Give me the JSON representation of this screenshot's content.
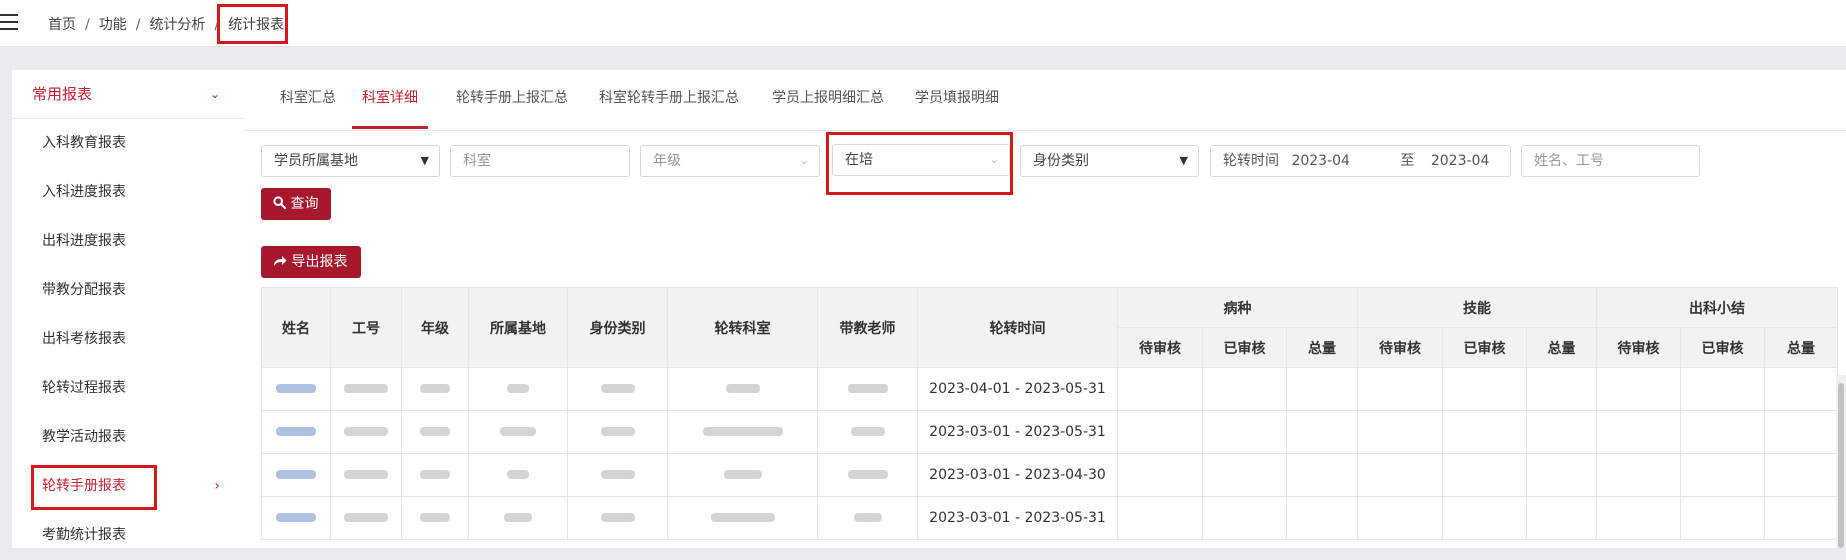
{
  "breadcrumb": {
    "items": [
      "首页",
      "功能",
      "统计分析",
      "统计报表"
    ],
    "separator": "/"
  },
  "sidebar": {
    "group_title": "常用报表",
    "items": [
      "入科教育报表",
      "入科进度报表",
      "出科进度报表",
      "带教分配报表",
      "出科考核报表",
      "轮转过程报表",
      "教学活动报表",
      "轮转手册报表",
      "考勤统计报表"
    ],
    "active_index": 7
  },
  "tabs": [
    {
      "label": "科室汇总",
      "active": false
    },
    {
      "label": "科室详细",
      "active": true
    },
    {
      "label": "轮转手册上报汇总",
      "active": false
    },
    {
      "label": "科室轮转手册上报汇总",
      "active": false
    },
    {
      "label": "学员上报明细汇总",
      "active": false
    },
    {
      "label": "学员填报明细",
      "active": false
    }
  ],
  "filters": {
    "base_select": "学员所属基地",
    "dept_placeholder": "科室",
    "grade_placeholder": "年级",
    "status_value": "在培",
    "identity_select": "身份类别",
    "rotation_label": "轮转时间",
    "rotation_from": "2023-04",
    "rotation_to_label": "至",
    "rotation_to": "2023-04",
    "name_placeholder": "姓名、工号"
  },
  "buttons": {
    "query": "查询",
    "export": "导出报表"
  },
  "table": {
    "headers": [
      "姓名",
      "工号",
      "年级",
      "所属基地",
      "身份类别",
      "轮转科室",
      "带教老师",
      "轮转时间"
    ],
    "groups": [
      "病种",
      "技能",
      "出科小结"
    ],
    "sub_headers": [
      "待审核",
      "已审核",
      "总量"
    ],
    "rows": [
      {
        "rotation_time": "2023-04-01 - 2023-05-31"
      },
      {
        "rotation_time": "2023-03-01 - 2023-05-31"
      },
      {
        "rotation_time": "2023-03-01 - 2023-04-30"
      },
      {
        "rotation_time": "2023-03-01 - 2023-05-31"
      }
    ]
  },
  "colors": {
    "accent": "#a8182d",
    "highlight": "#d9161c"
  }
}
